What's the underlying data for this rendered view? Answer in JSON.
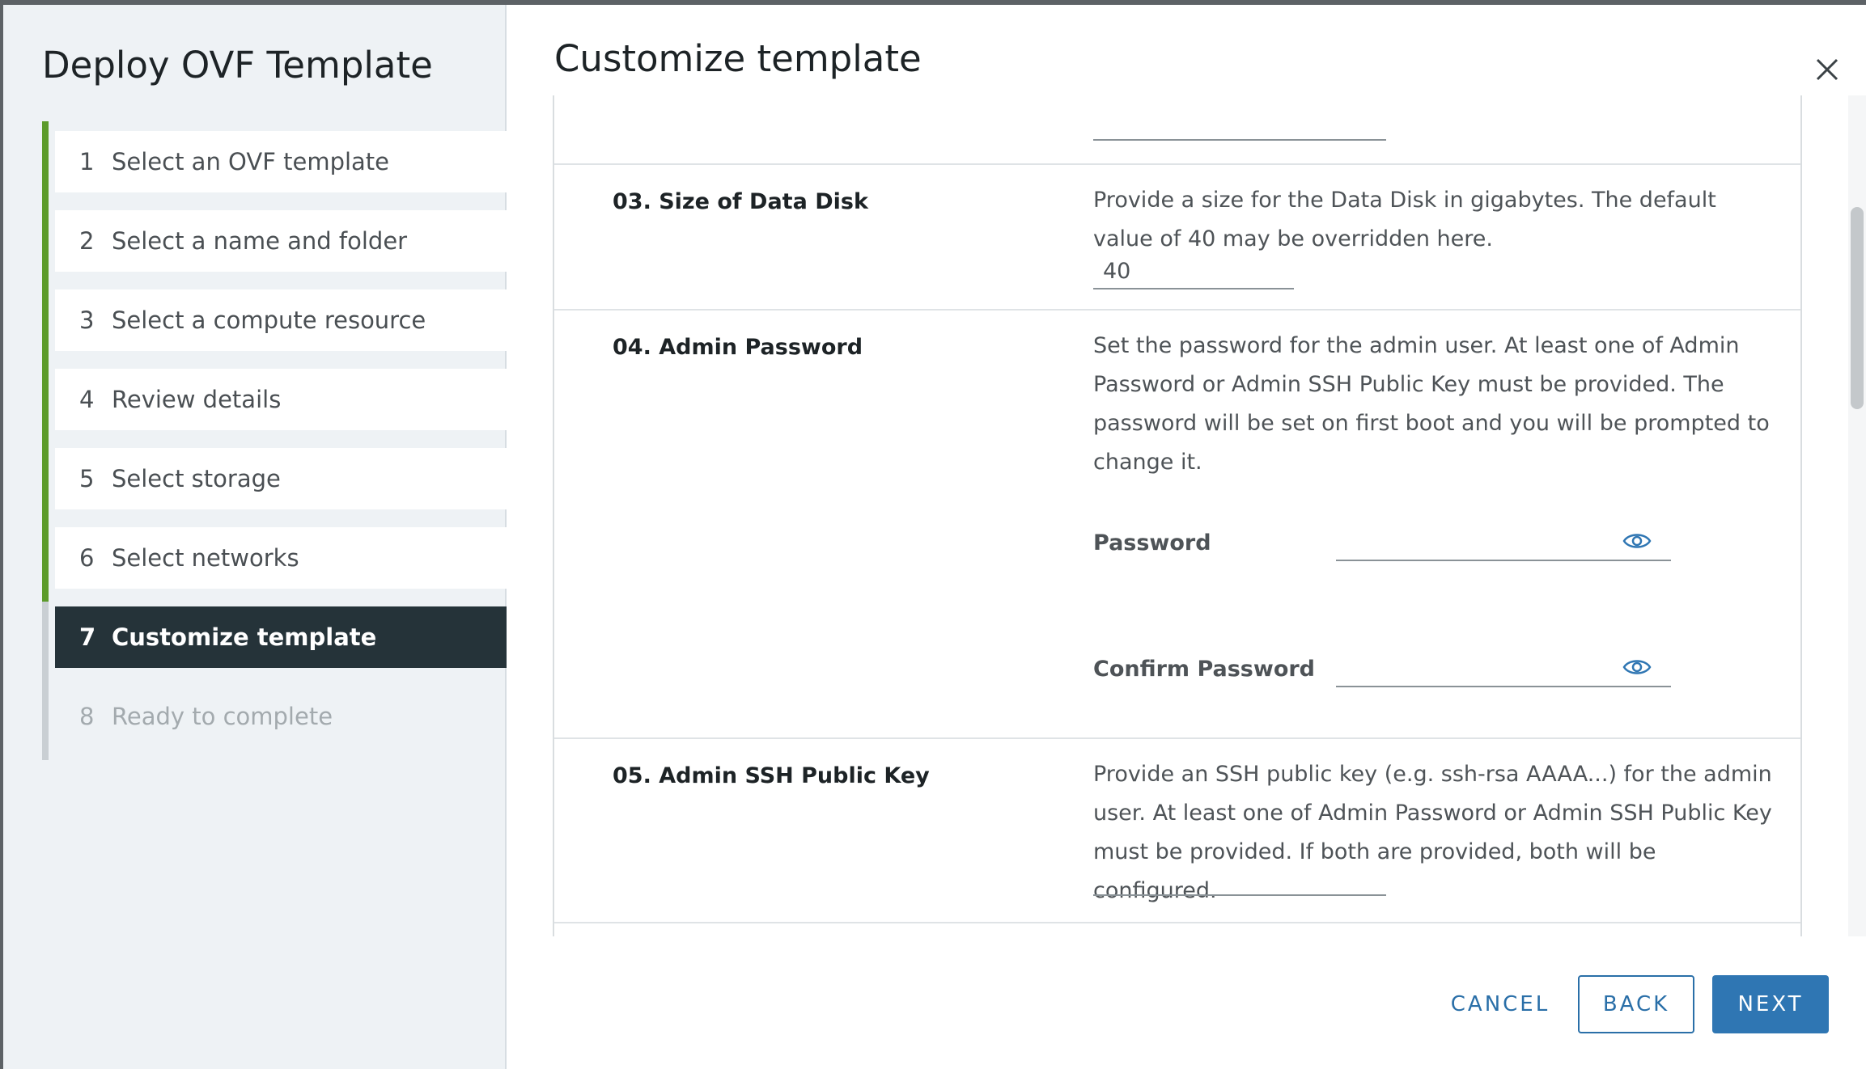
{
  "wizard": {
    "title": "Deploy OVF Template",
    "steps": [
      {
        "num": "1",
        "label": "Select an OVF template"
      },
      {
        "num": "2",
        "label": "Select a name and folder"
      },
      {
        "num": "3",
        "label": "Select a compute resource"
      },
      {
        "num": "4",
        "label": "Review details"
      },
      {
        "num": "5",
        "label": "Select storage"
      },
      {
        "num": "6",
        "label": "Select networks"
      },
      {
        "num": "7",
        "label": "Customize template"
      },
      {
        "num": "8",
        "label": "Ready to complete"
      }
    ],
    "active_step": 7
  },
  "main": {
    "title": "Customize template",
    "properties": {
      "data_disk": {
        "label": "03. Size of Data Disk",
        "description": "Provide a size for the Data Disk in gigabytes. The default value of 40 may be overridden here.",
        "value": "40"
      },
      "admin_password": {
        "label": "04. Admin Password",
        "description": "Set the password for the admin user. At least one of Admin Password or Admin SSH Public Key must be provided. The password will be set on first boot and you will be prompted to change it.",
        "password_label": "Password",
        "confirm_label": "Confirm Password",
        "password_value": "",
        "confirm_value": ""
      },
      "ssh_key": {
        "label": "05. Admin SSH Public Key",
        "description": "Provide an SSH public key (e.g. ssh-rsa AAAA...) for the admin user. At least one of Admin Password or Admin SSH Public Key must be provided. If both are provided, both will be configured.",
        "value": ""
      }
    }
  },
  "footer": {
    "cancel": "CANCEL",
    "back": "BACK",
    "next": "NEXT"
  },
  "colors": {
    "progress_done": "#5c9b2b",
    "active_step_bg": "#253339",
    "primary": "#2f76b3"
  }
}
